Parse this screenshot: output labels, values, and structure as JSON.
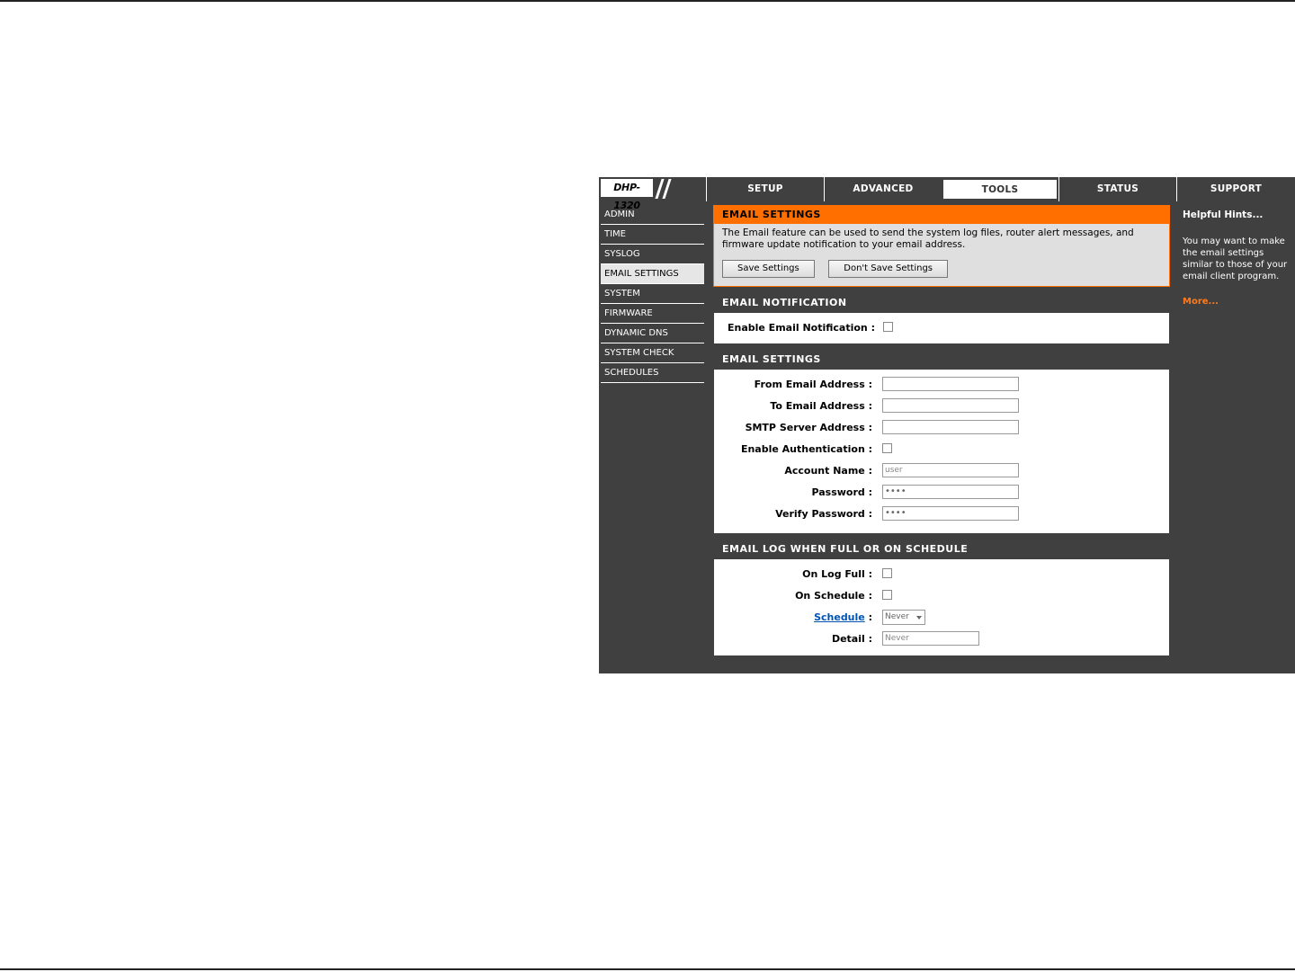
{
  "logo": {
    "text": "DHP-1320"
  },
  "tabs": [
    {
      "label": "SETUP"
    },
    {
      "label": "ADVANCED"
    },
    {
      "label": "TOOLS"
    },
    {
      "label": "STATUS"
    },
    {
      "label": "SUPPORT"
    }
  ],
  "active_tab": "TOOLS",
  "menu": {
    "items": [
      {
        "label": "ADMIN"
      },
      {
        "label": "TIME"
      },
      {
        "label": "SYSLOG"
      },
      {
        "label": "EMAIL SETTINGS"
      },
      {
        "label": "SYSTEM"
      },
      {
        "label": "FIRMWARE"
      },
      {
        "label": "DYNAMIC DNS"
      },
      {
        "label": "SYSTEM CHECK"
      },
      {
        "label": "SCHEDULES"
      }
    ],
    "active": "EMAIL SETTINGS"
  },
  "intro": {
    "title": "EMAIL SETTINGS",
    "text": "The Email feature can be used to send the system log files, router alert messages, and firmware update notification to your email address.",
    "save_label": "Save Settings",
    "dont_save_label": "Don't Save Settings"
  },
  "notification": {
    "title": "EMAIL NOTIFICATION",
    "enable_label": "Enable Email Notification :",
    "enabled": false
  },
  "email_settings": {
    "title": "EMAIL SETTINGS",
    "from_label": "From Email Address :",
    "from_value": "",
    "to_label": "To Email Address :",
    "to_value": "",
    "smtp_label": "SMTP Server Address :",
    "smtp_value": "",
    "auth_label": "Enable Authentication :",
    "auth_enabled": false,
    "account_label": "Account Name :",
    "account_value": "user",
    "password_label": "Password :",
    "password_value": "••••",
    "verify_label": "Verify Password :",
    "verify_value": "••••"
  },
  "email_log": {
    "title": "EMAIL LOG WHEN FULL OR ON SCHEDULE",
    "log_full_label": "On Log Full :",
    "on_schedule_label": "On Schedule :",
    "schedule_link": "Schedule",
    "schedule_colon": ":",
    "schedule_value": "Never",
    "detail_label": "Detail :",
    "detail_value": "Never"
  },
  "hints": {
    "title": "Helpful Hints...",
    "text": "You may want to make the email settings similar to those of your email client program.",
    "more": "More..."
  },
  "colors": {
    "accent": "#ff6f00",
    "frame": "#404040",
    "link": "#0055b3",
    "more": "#ff7a1a"
  }
}
